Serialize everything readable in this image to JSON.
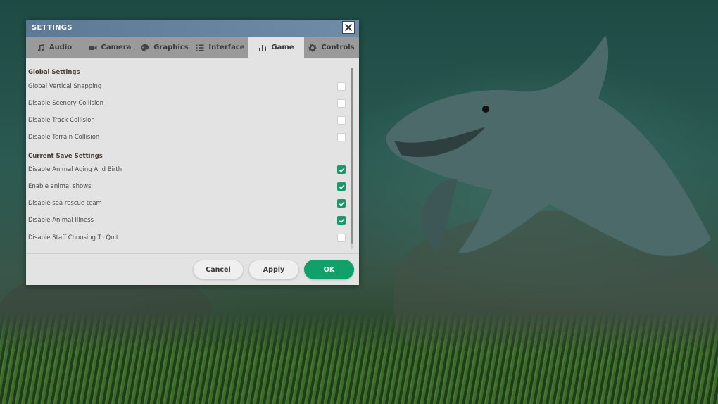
{
  "dialog": {
    "title": "SETTINGS",
    "close_icon": "close-icon"
  },
  "tabs": [
    {
      "label": "Audio",
      "icon": "music-note-icon",
      "active": false
    },
    {
      "label": "Camera",
      "icon": "video-camera-icon",
      "active": false
    },
    {
      "label": "Graphics",
      "icon": "palette-icon",
      "active": false
    },
    {
      "label": "Interface",
      "icon": "list-icon",
      "active": false
    },
    {
      "label": "Game",
      "icon": "bar-chart-icon",
      "active": true
    },
    {
      "label": "Controls",
      "icon": "gear-icon",
      "active": false
    }
  ],
  "sections": {
    "global": {
      "header": "Global Settings",
      "items": [
        {
          "label": "Global Vertical Snapping",
          "checked": false
        },
        {
          "label": "Disable Scenery Collision",
          "checked": false
        },
        {
          "label": "Disable Track Collision",
          "checked": false
        },
        {
          "label": "Disable Terrain Collision",
          "checked": false
        }
      ]
    },
    "save": {
      "header": "Current Save Settings",
      "items": [
        {
          "label": "Disable Animal Aging And Birth",
          "checked": true
        },
        {
          "label": "Enable animal shows",
          "checked": true
        },
        {
          "label": "Disable sea rescue team",
          "checked": true
        },
        {
          "label": "Disable Animal Illness",
          "checked": true
        },
        {
          "label": "Disable Staff Choosing To Quit",
          "checked": false
        }
      ]
    }
  },
  "buttons": {
    "cancel": "Cancel",
    "apply": "Apply",
    "ok": "OK"
  },
  "colors": {
    "accent": "#12a06a",
    "titlebar": "#6f8ca6",
    "checkbox_checked": "#1a9a6a"
  }
}
